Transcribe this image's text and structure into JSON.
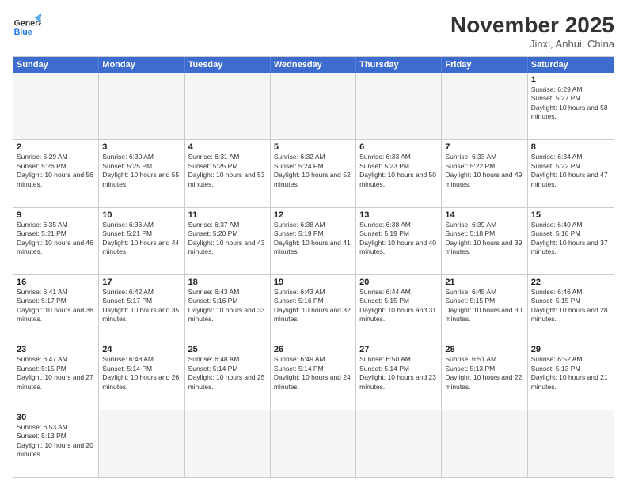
{
  "header": {
    "logo": {
      "general": "General",
      "blue": "Blue"
    },
    "title": "November 2025",
    "location": "Jinxi, Anhui, China"
  },
  "weekdays": [
    "Sunday",
    "Monday",
    "Tuesday",
    "Wednesday",
    "Thursday",
    "Friday",
    "Saturday"
  ],
  "weeks": [
    [
      {
        "day": "",
        "info": ""
      },
      {
        "day": "",
        "info": ""
      },
      {
        "day": "",
        "info": ""
      },
      {
        "day": "",
        "info": ""
      },
      {
        "day": "",
        "info": ""
      },
      {
        "day": "",
        "info": ""
      },
      {
        "day": "1",
        "info": "Sunrise: 6:29 AM\nSunset: 5:27 PM\nDaylight: 10 hours and 58 minutes."
      }
    ],
    [
      {
        "day": "2",
        "info": "Sunrise: 6:29 AM\nSunset: 5:26 PM\nDaylight: 10 hours and 56 minutes."
      },
      {
        "day": "3",
        "info": "Sunrise: 6:30 AM\nSunset: 5:25 PM\nDaylight: 10 hours and 55 minutes."
      },
      {
        "day": "4",
        "info": "Sunrise: 6:31 AM\nSunset: 5:25 PM\nDaylight: 10 hours and 53 minutes."
      },
      {
        "day": "5",
        "info": "Sunrise: 6:32 AM\nSunset: 5:24 PM\nDaylight: 10 hours and 52 minutes."
      },
      {
        "day": "6",
        "info": "Sunrise: 6:33 AM\nSunset: 5:23 PM\nDaylight: 10 hours and 50 minutes."
      },
      {
        "day": "7",
        "info": "Sunrise: 6:33 AM\nSunset: 5:22 PM\nDaylight: 10 hours and 49 minutes."
      },
      {
        "day": "8",
        "info": "Sunrise: 6:34 AM\nSunset: 5:22 PM\nDaylight: 10 hours and 47 minutes."
      }
    ],
    [
      {
        "day": "9",
        "info": "Sunrise: 6:35 AM\nSunset: 5:21 PM\nDaylight: 10 hours and 46 minutes."
      },
      {
        "day": "10",
        "info": "Sunrise: 6:36 AM\nSunset: 5:21 PM\nDaylight: 10 hours and 44 minutes."
      },
      {
        "day": "11",
        "info": "Sunrise: 6:37 AM\nSunset: 5:20 PM\nDaylight: 10 hours and 43 minutes."
      },
      {
        "day": "12",
        "info": "Sunrise: 6:38 AM\nSunset: 5:19 PM\nDaylight: 10 hours and 41 minutes."
      },
      {
        "day": "13",
        "info": "Sunrise: 6:38 AM\nSunset: 5:19 PM\nDaylight: 10 hours and 40 minutes."
      },
      {
        "day": "14",
        "info": "Sunrise: 6:39 AM\nSunset: 5:18 PM\nDaylight: 10 hours and 39 minutes."
      },
      {
        "day": "15",
        "info": "Sunrise: 6:40 AM\nSunset: 5:18 PM\nDaylight: 10 hours and 37 minutes."
      }
    ],
    [
      {
        "day": "16",
        "info": "Sunrise: 6:41 AM\nSunset: 5:17 PM\nDaylight: 10 hours and 36 minutes."
      },
      {
        "day": "17",
        "info": "Sunrise: 6:42 AM\nSunset: 5:17 PM\nDaylight: 10 hours and 35 minutes."
      },
      {
        "day": "18",
        "info": "Sunrise: 6:43 AM\nSunset: 5:16 PM\nDaylight: 10 hours and 33 minutes."
      },
      {
        "day": "19",
        "info": "Sunrise: 6:43 AM\nSunset: 5:16 PM\nDaylight: 10 hours and 32 minutes."
      },
      {
        "day": "20",
        "info": "Sunrise: 6:44 AM\nSunset: 5:15 PM\nDaylight: 10 hours and 31 minutes."
      },
      {
        "day": "21",
        "info": "Sunrise: 6:45 AM\nSunset: 5:15 PM\nDaylight: 10 hours and 30 minutes."
      },
      {
        "day": "22",
        "info": "Sunrise: 6:46 AM\nSunset: 5:15 PM\nDaylight: 10 hours and 28 minutes."
      }
    ],
    [
      {
        "day": "23",
        "info": "Sunrise: 6:47 AM\nSunset: 5:15 PM\nDaylight: 10 hours and 27 minutes."
      },
      {
        "day": "24",
        "info": "Sunrise: 6:48 AM\nSunset: 5:14 PM\nDaylight: 10 hours and 26 minutes."
      },
      {
        "day": "25",
        "info": "Sunrise: 6:48 AM\nSunset: 5:14 PM\nDaylight: 10 hours and 25 minutes."
      },
      {
        "day": "26",
        "info": "Sunrise: 6:49 AM\nSunset: 5:14 PM\nDaylight: 10 hours and 24 minutes."
      },
      {
        "day": "27",
        "info": "Sunrise: 6:50 AM\nSunset: 5:14 PM\nDaylight: 10 hours and 23 minutes."
      },
      {
        "day": "28",
        "info": "Sunrise: 6:51 AM\nSunset: 5:13 PM\nDaylight: 10 hours and 22 minutes."
      },
      {
        "day": "29",
        "info": "Sunrise: 6:52 AM\nSunset: 5:13 PM\nDaylight: 10 hours and 21 minutes."
      }
    ],
    [
      {
        "day": "30",
        "info": "Sunrise: 6:53 AM\nSunset: 5:13 PM\nDaylight: 10 hours and 20 minutes."
      },
      {
        "day": "",
        "info": ""
      },
      {
        "day": "",
        "info": ""
      },
      {
        "day": "",
        "info": ""
      },
      {
        "day": "",
        "info": ""
      },
      {
        "day": "",
        "info": ""
      },
      {
        "day": "",
        "info": ""
      }
    ]
  ]
}
